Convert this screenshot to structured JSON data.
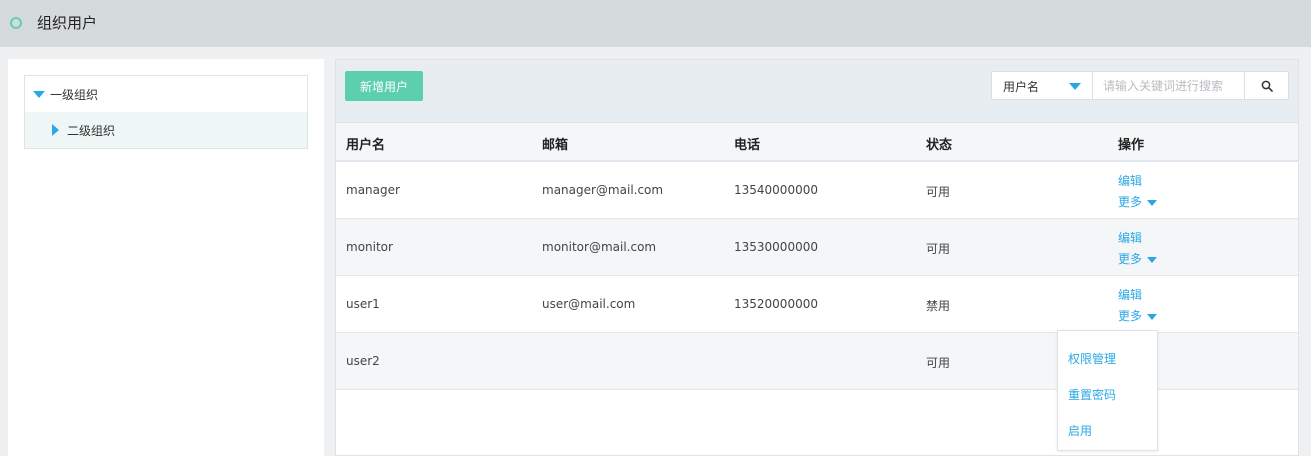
{
  "header": {
    "title": "组织用户"
  },
  "tree": {
    "nodes": [
      {
        "label": "一级组织"
      },
      {
        "label": "二级组织"
      }
    ]
  },
  "toolbar": {
    "add_user_label": "新增用户",
    "search_field_value": "用户名",
    "search_placeholder": "请输入关键词进行搜索"
  },
  "table": {
    "columns": [
      "用户名",
      "邮箱",
      "电话",
      "状态",
      "操作"
    ],
    "rows": [
      {
        "username": "manager",
        "email": "manager@mail.com",
        "phone": "13540000000",
        "status": "可用",
        "edit": "编辑",
        "more": "更多"
      },
      {
        "username": "monitor",
        "email": "monitor@mail.com",
        "phone": "13530000000",
        "status": "可用",
        "edit": "编辑",
        "more": "更多"
      },
      {
        "username": "user1",
        "email": "user@mail.com",
        "phone": "13520000000",
        "status": "禁用",
        "edit": "编辑",
        "more": "更多"
      },
      {
        "username": "user2",
        "email": "",
        "phone": "",
        "status": "可用"
      }
    ]
  },
  "more_menu": {
    "items": [
      "权限管理",
      "重置密码",
      "启用"
    ]
  },
  "colors": {
    "accent_green": "#5ccfb0",
    "link_blue": "#2aa8e6",
    "header_bg": "#d5dadd"
  }
}
